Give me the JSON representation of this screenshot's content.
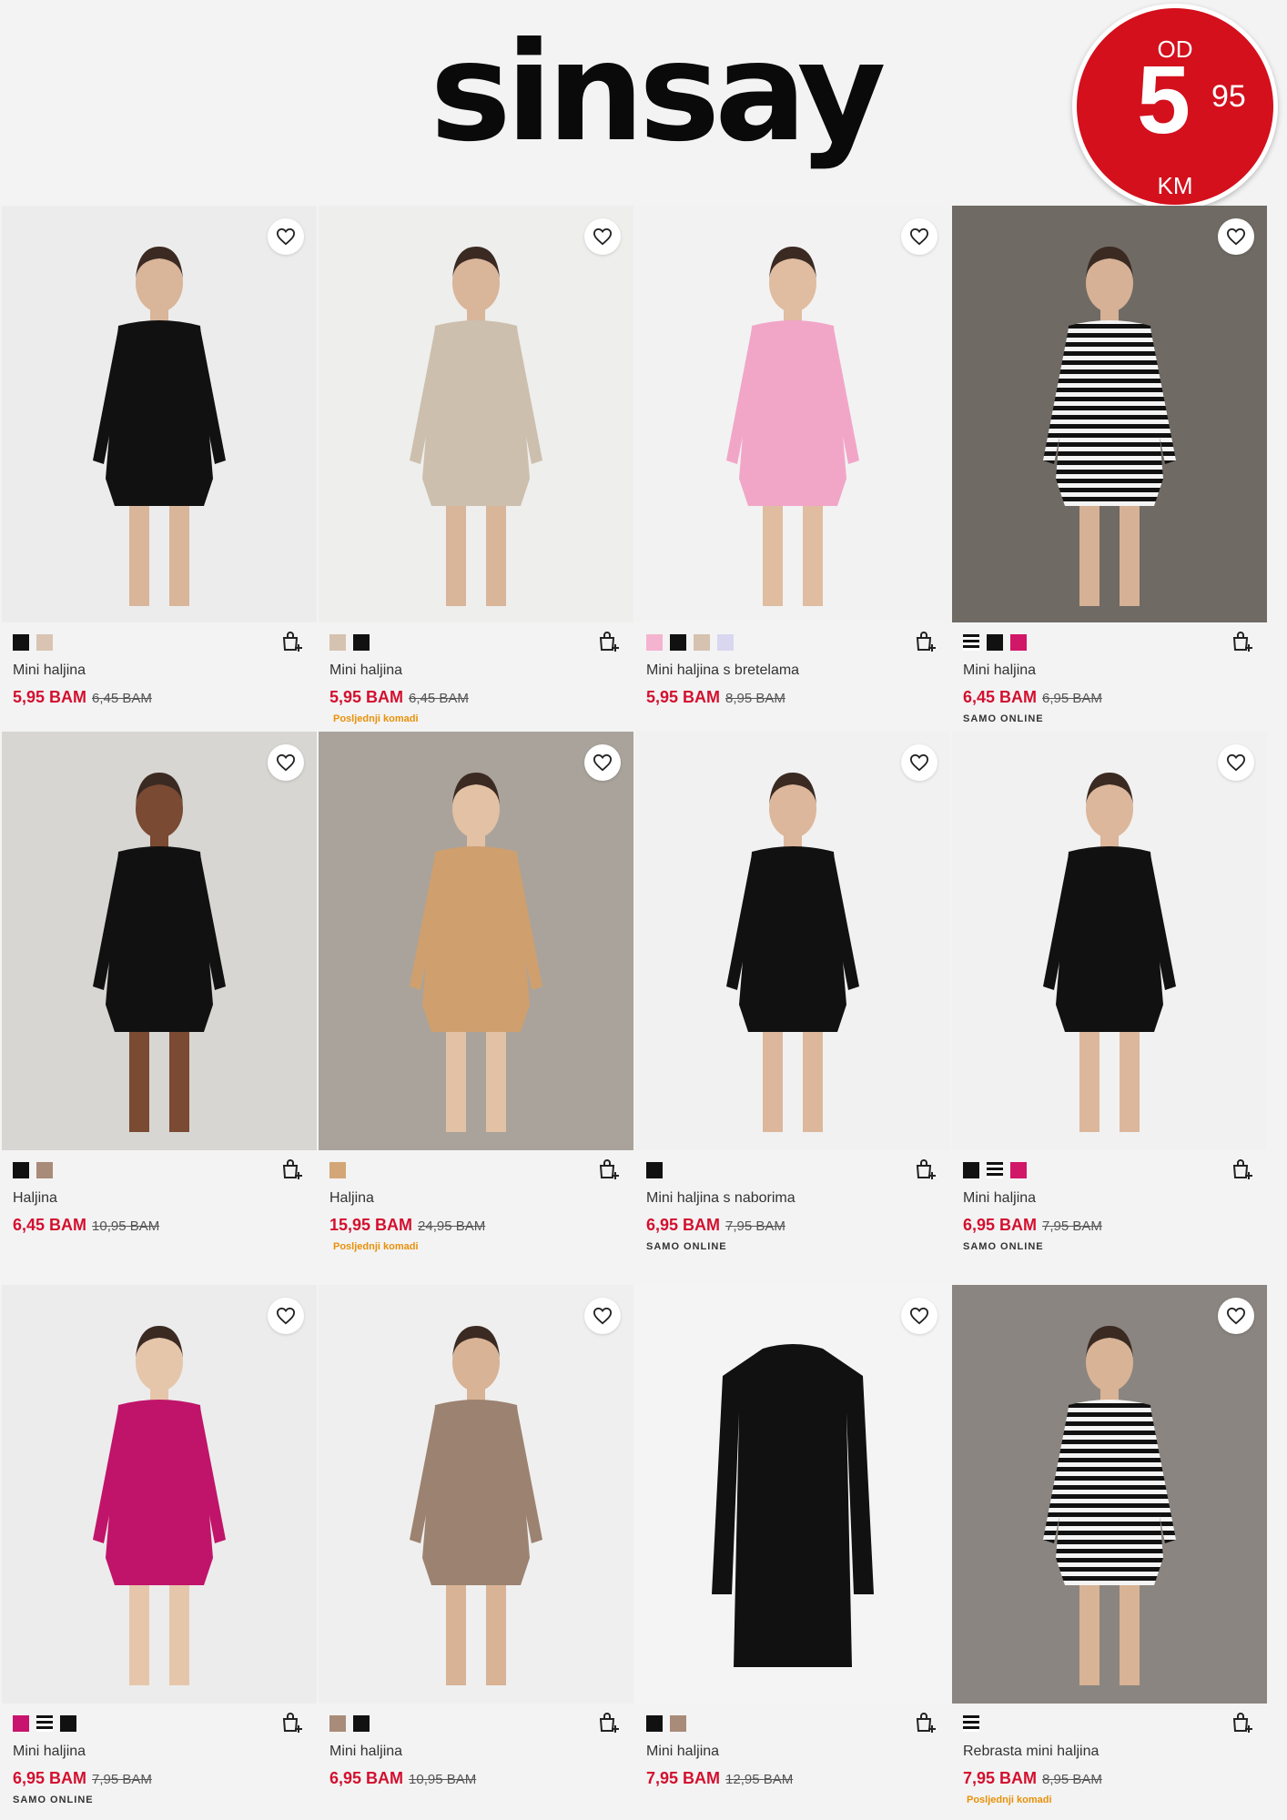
{
  "brand": {
    "logo_text": "sinsay",
    "promo_badge": {
      "prefix": "OD",
      "amount": "5",
      "cents": "95",
      "unit": "KM"
    }
  },
  "colors": {
    "badge_red": "#d3101c",
    "price_red": "#d3102f",
    "limited_orange": "#e8910a"
  },
  "products": [
    {
      "name": "Mini haljina",
      "price": "5,95 BAM",
      "old_price": "6,45 BAM",
      "tag": "",
      "swatches": [
        "#111111",
        "#d9c4b3"
      ]
    },
    {
      "name": "Mini haljina",
      "price": "5,95 BAM",
      "old_price": "6,45 BAM",
      "tag": "Posljednji komadi",
      "swatches": [
        "#d6c2b0",
        "#111111"
      ]
    },
    {
      "name": "Mini haljina s bretelama",
      "price": "5,95 BAM",
      "old_price": "8,95 BAM",
      "tag": "",
      "swatches": [
        "#f4b4cf",
        "#111111",
        "#d6c2b0",
        "#d9d6f0"
      ]
    },
    {
      "name": "Mini haljina",
      "price": "6,45 BAM",
      "old_price": "6,95 BAM",
      "tag": "SAMO ONLINE",
      "swatches": [
        "striped",
        "#111111",
        "#d11767"
      ]
    },
    {
      "name": "Haljina",
      "price": "6,45 BAM",
      "old_price": "10,95 BAM",
      "tag": "",
      "swatches": [
        "#111111",
        "#a88b78"
      ]
    },
    {
      "name": "Haljina",
      "price": "15,95 BAM",
      "old_price": "24,95 BAM",
      "tag": "Posljednji komadi",
      "swatches": [
        "#d3a677"
      ]
    },
    {
      "name": "Mini haljina s naborima",
      "price": "6,95 BAM",
      "old_price": "7,95 BAM",
      "tag": "SAMO ONLINE",
      "swatches": [
        "#111111"
      ]
    },
    {
      "name": "Mini haljina",
      "price": "6,95 BAM",
      "old_price": "7,95 BAM",
      "tag": "SAMO ONLINE",
      "swatches": [
        "#111111",
        "striped",
        "#d11767"
      ]
    },
    {
      "name": "Mini haljina",
      "price": "6,95 BAM",
      "old_price": "7,95 BAM",
      "tag": "SAMO ONLINE",
      "swatches": [
        "#c8146e",
        "striped",
        "#111111"
      ]
    },
    {
      "name": "Mini haljina",
      "price": "6,95 BAM",
      "old_price": "10,95 BAM",
      "tag": "",
      "swatches": [
        "#a88b78",
        "#111111"
      ]
    },
    {
      "name": "Mini haljina",
      "price": "7,95 BAM",
      "old_price": "12,95 BAM",
      "tag": "",
      "swatches": [
        "#111111",
        "#a88b78"
      ]
    },
    {
      "name": "Rebrasta mini haljina",
      "price": "7,95 BAM",
      "old_price": "8,95 BAM",
      "tag": "Posljednji komadi",
      "swatches": [
        "striped"
      ]
    }
  ]
}
